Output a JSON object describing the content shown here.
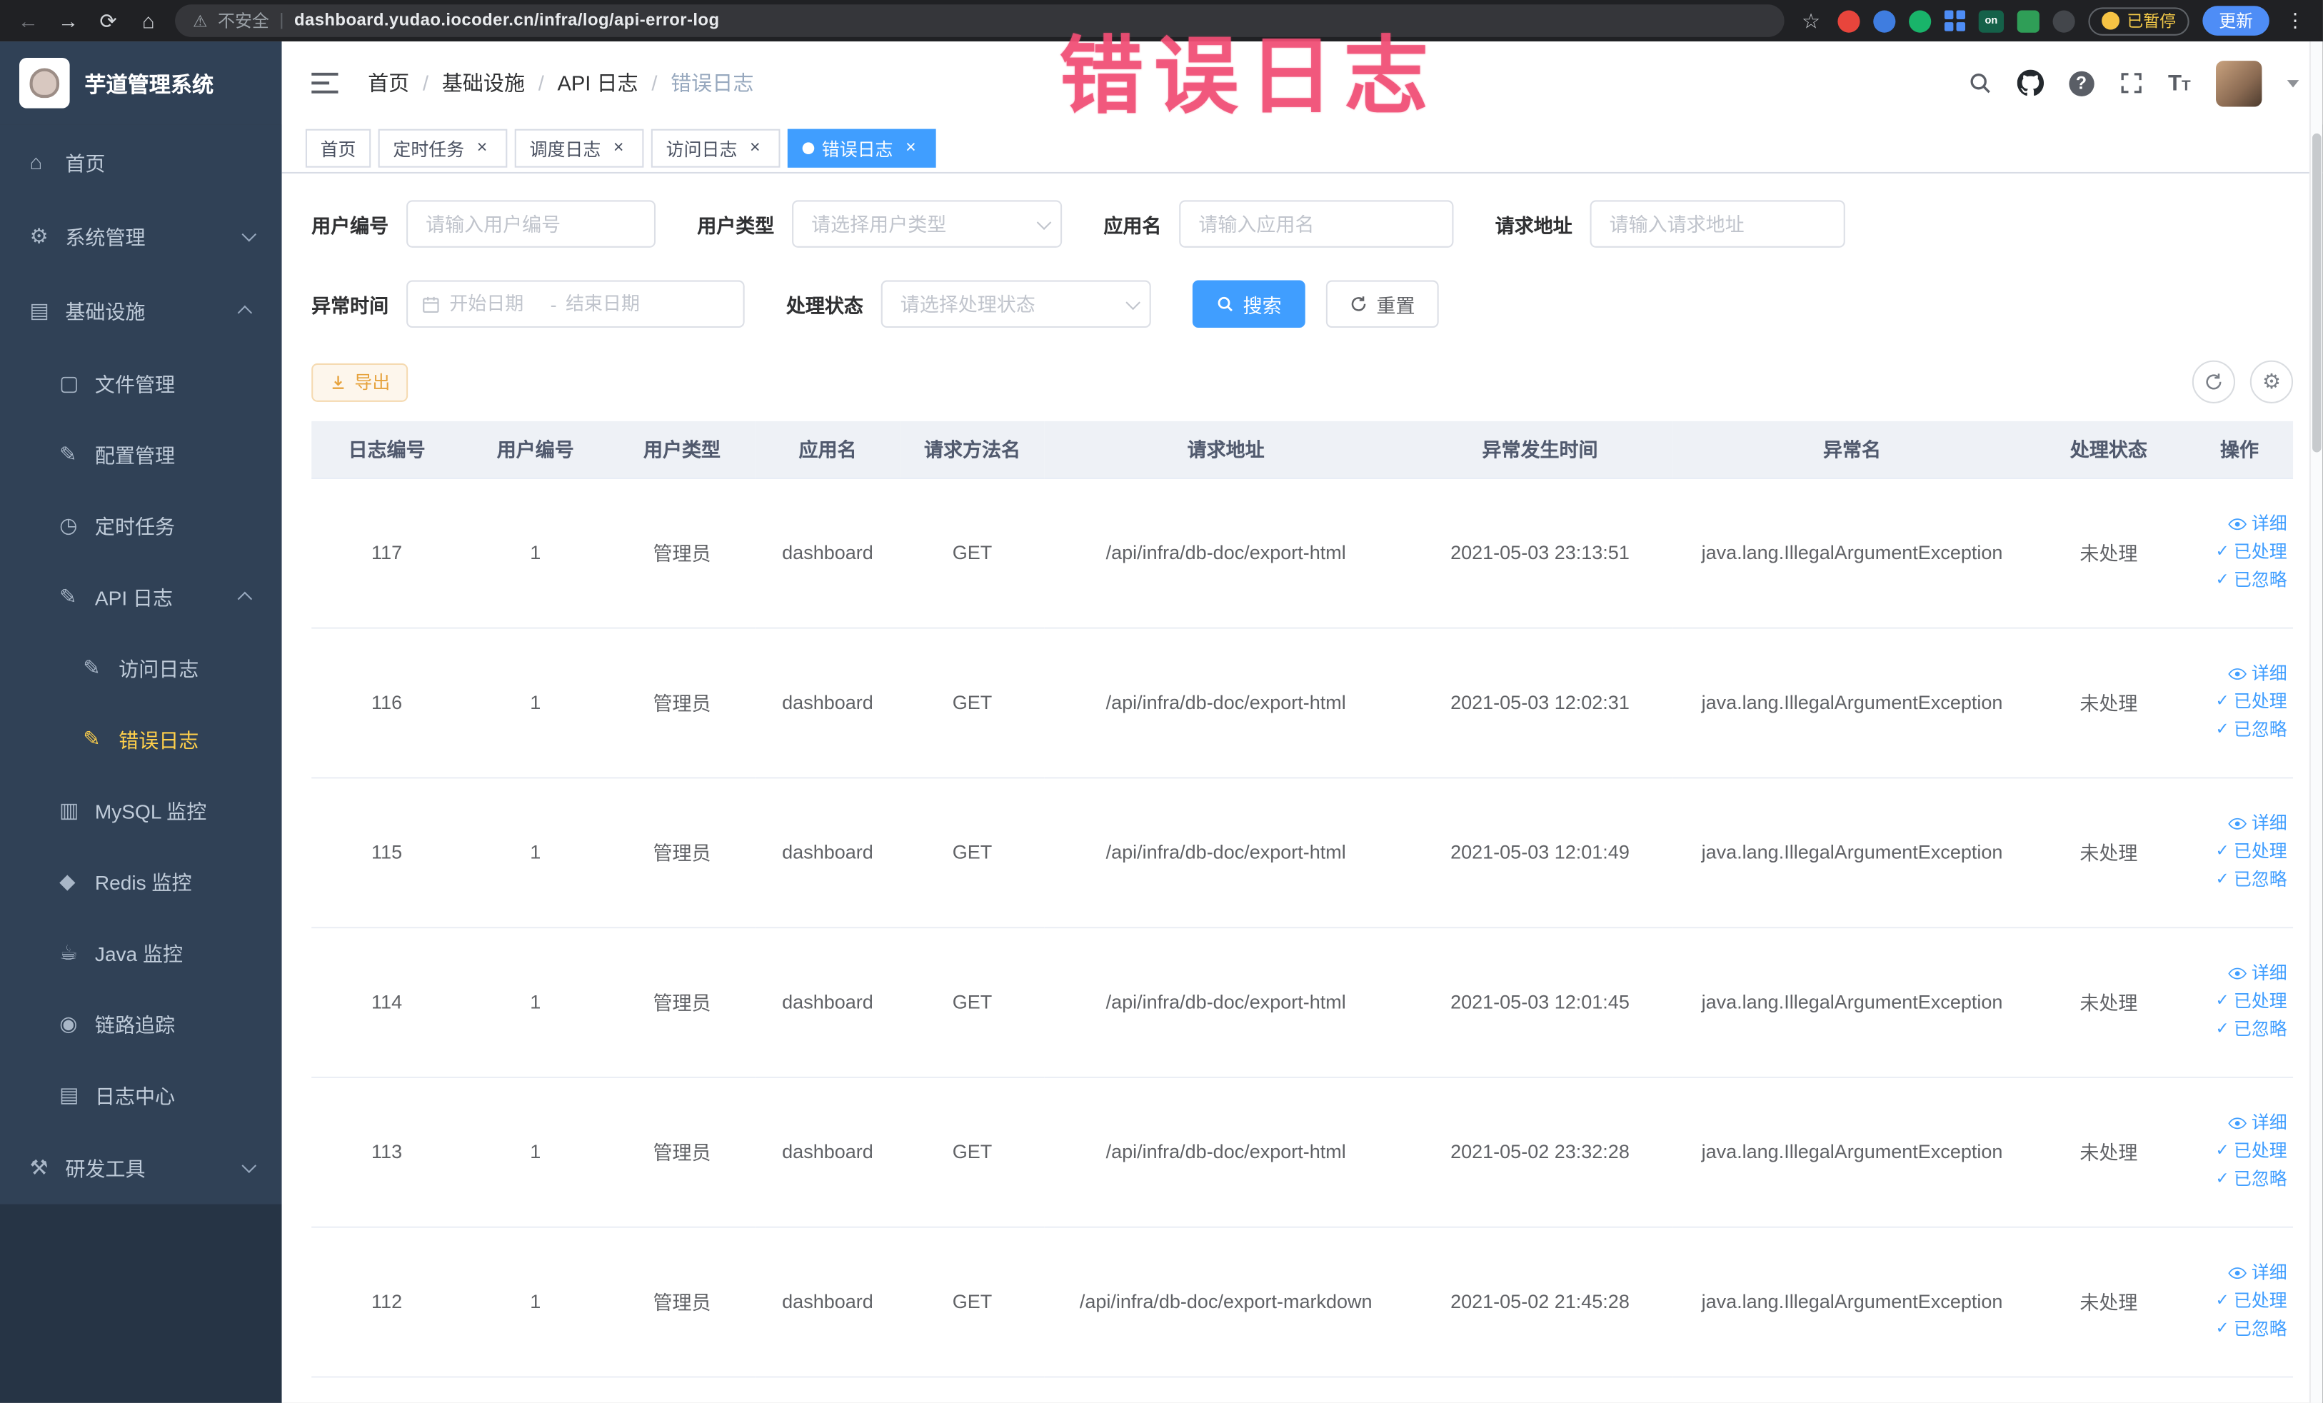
{
  "browser": {
    "security_label": "不安全",
    "divider": "|",
    "url": "dashboard.yudao.iocoder.cn/infra/log/api-error-log",
    "paused_badge": "已暂停",
    "update_button": "更新"
  },
  "icons": {
    "back": "←",
    "forward": "→",
    "reload": "⟳",
    "home": "⌂",
    "star": "☆",
    "warning": "⚠",
    "kebab": "⋮",
    "gear": "⚙",
    "question": "?",
    "on_badge": "on",
    "check": "✓"
  },
  "watermark": "错误日志",
  "sidebar": {
    "logo_title": "芋道管理系统",
    "items": [
      {
        "key": "home",
        "label": "首页",
        "icon": "home-icon",
        "glyph": "⌂",
        "level": 0
      },
      {
        "key": "system",
        "label": "系统管理",
        "icon": "gear-icon",
        "glyph": "⚙",
        "level": 0,
        "chevron": "down"
      },
      {
        "key": "infra",
        "label": "基础设施",
        "icon": "monitor-icon",
        "glyph": "▤",
        "level": 0,
        "chevron": "up"
      },
      {
        "key": "file",
        "label": "文件管理",
        "icon": "folder-icon",
        "glyph": "▢",
        "level": 1
      },
      {
        "key": "config",
        "label": "配置管理",
        "icon": "edit-icon",
        "glyph": "✎",
        "level": 1
      },
      {
        "key": "job",
        "label": "定时任务",
        "icon": "timer-icon",
        "glyph": "◷",
        "level": 1
      },
      {
        "key": "api-log",
        "label": "API 日志",
        "icon": "document-icon",
        "glyph": "✎",
        "level": 1,
        "chevron": "up"
      },
      {
        "key": "access-log",
        "label": "访问日志",
        "icon": "document-icon",
        "glyph": "✎",
        "level": 2
      },
      {
        "key": "error-log",
        "label": "错误日志",
        "icon": "document-icon",
        "glyph": "✎",
        "level": 2,
        "active": true
      },
      {
        "key": "mysql",
        "label": "MySQL 监控",
        "icon": "database-icon",
        "glyph": "▥",
        "level": 1
      },
      {
        "key": "redis",
        "label": "Redis 监控",
        "icon": "redis-icon",
        "glyph": "◆",
        "level": 1
      },
      {
        "key": "java",
        "label": "Java 监控",
        "icon": "coffee-icon",
        "glyph": "☕",
        "level": 1
      },
      {
        "key": "trace",
        "label": "链路追踪",
        "icon": "eye-icon",
        "glyph": "◉",
        "level": 1
      },
      {
        "key": "log-center",
        "label": "日志中心",
        "icon": "log-icon",
        "glyph": "▤",
        "level": 1
      },
      {
        "key": "dev-tools",
        "label": "研发工具",
        "icon": "tools-icon",
        "glyph": "⚒",
        "level": 0,
        "chevron": "down"
      }
    ]
  },
  "header": {
    "breadcrumb": [
      "首页",
      "基础设施",
      "API 日志",
      "错误日志"
    ]
  },
  "tabs": [
    {
      "key": "home",
      "label": "首页",
      "closable": false,
      "active": false
    },
    {
      "key": "job",
      "label": "定时任务",
      "closable": true,
      "active": false
    },
    {
      "key": "job-log",
      "label": "调度日志",
      "closable": true,
      "active": false
    },
    {
      "key": "access-log",
      "label": "访问日志",
      "closable": true,
      "active": false
    },
    {
      "key": "error-log",
      "label": "错误日志",
      "closable": true,
      "active": true
    }
  ],
  "filters": {
    "user_id": {
      "label": "用户编号",
      "placeholder": "请输入用户编号"
    },
    "user_type": {
      "label": "用户类型",
      "placeholder": "请选择用户类型"
    },
    "app_name": {
      "label": "应用名",
      "placeholder": "请输入应用名"
    },
    "request_url": {
      "label": "请求地址",
      "placeholder": "请输入请求地址"
    },
    "exception_time": {
      "label": "异常时间",
      "start_placeholder": "开始日期",
      "separator": "-",
      "end_placeholder": "结束日期"
    },
    "process_status": {
      "label": "处理状态",
      "placeholder": "请选择处理状态"
    },
    "search_button": "搜索",
    "reset_button": "重置"
  },
  "toolbar": {
    "export_button": "导出"
  },
  "table": {
    "columns": [
      "日志编号",
      "用户编号",
      "用户类型",
      "应用名",
      "请求方法名",
      "请求地址",
      "异常发生时间",
      "异常名",
      "处理状态",
      "操作"
    ],
    "actions": [
      {
        "key": "detail",
        "label": "详细"
      },
      {
        "key": "processed",
        "label": "已处理"
      },
      {
        "key": "ignored",
        "label": "已忽略"
      }
    ],
    "rows": [
      {
        "log_id": "117",
        "user_id": "1",
        "user_type": "管理员",
        "app_name": "dashboard",
        "method": "GET",
        "url": "/api/infra/db-doc/export-html",
        "time": "2021-05-03 23:13:51",
        "exception": "java.lang.IllegalArgumentException",
        "status": "未处理"
      },
      {
        "log_id": "116",
        "user_id": "1",
        "user_type": "管理员",
        "app_name": "dashboard",
        "method": "GET",
        "url": "/api/infra/db-doc/export-html",
        "time": "2021-05-03 12:02:31",
        "exception": "java.lang.IllegalArgumentException",
        "status": "未处理"
      },
      {
        "log_id": "115",
        "user_id": "1",
        "user_type": "管理员",
        "app_name": "dashboard",
        "method": "GET",
        "url": "/api/infra/db-doc/export-html",
        "time": "2021-05-03 12:01:49",
        "exception": "java.lang.IllegalArgumentException",
        "status": "未处理"
      },
      {
        "log_id": "114",
        "user_id": "1",
        "user_type": "管理员",
        "app_name": "dashboard",
        "method": "GET",
        "url": "/api/infra/db-doc/export-html",
        "time": "2021-05-03 12:01:45",
        "exception": "java.lang.IllegalArgumentException",
        "status": "未处理"
      },
      {
        "log_id": "113",
        "user_id": "1",
        "user_type": "管理员",
        "app_name": "dashboard",
        "method": "GET",
        "url": "/api/infra/db-doc/export-html",
        "time": "2021-05-02 23:32:28",
        "exception": "java.lang.IllegalArgumentException",
        "status": "未处理"
      },
      {
        "log_id": "112",
        "user_id": "1",
        "user_type": "管理员",
        "app_name": "dashboard",
        "method": "GET",
        "url": "/api/infra/db-doc/export-markdown",
        "time": "2021-05-02 21:45:28",
        "exception": "java.lang.IllegalArgumentException",
        "status": "未处理"
      }
    ]
  }
}
